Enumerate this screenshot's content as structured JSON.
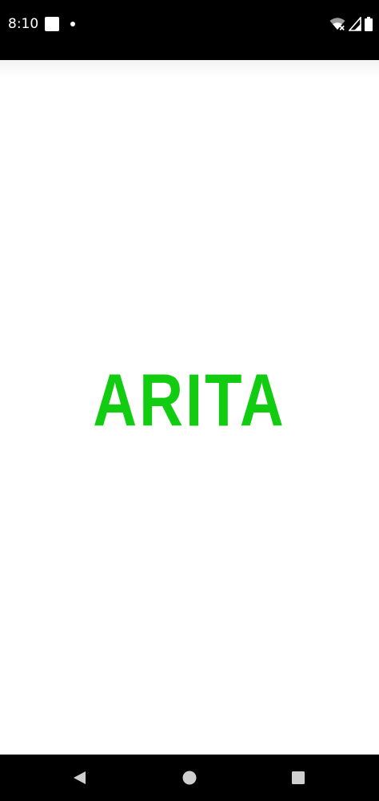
{
  "status_bar": {
    "time": "8:10",
    "icons": [
      "notification-square-icon",
      "notification-dot-icon",
      "wifi-off-icon",
      "signal-icon",
      "battery-icon"
    ],
    "background": "#000000"
  },
  "splash": {
    "logo_text": "ARITA",
    "logo_color": "#11cc11",
    "background": "#ffffff"
  },
  "nav_bar": {
    "buttons": [
      "back-icon",
      "home-icon",
      "recents-icon"
    ],
    "background": "#000000",
    "icon_color": "#cfcfcf"
  }
}
